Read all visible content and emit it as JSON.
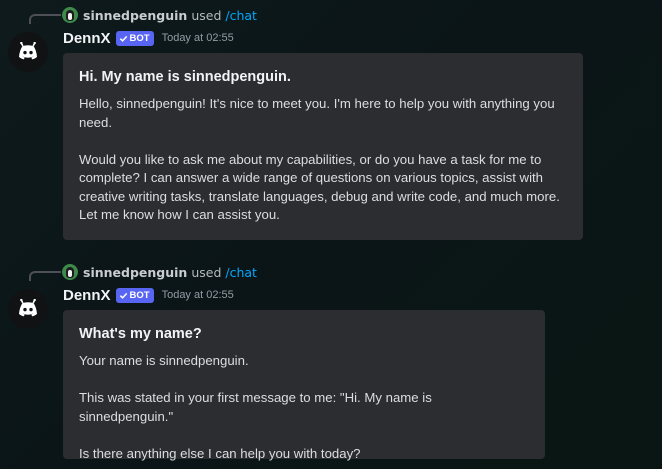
{
  "messages": [
    {
      "interaction": {
        "user": "sinnedpenguin",
        "used_text": "used",
        "command": "/chat"
      },
      "author": {
        "name": "DennX",
        "badge": "BOT"
      },
      "timestamp": "Today at 02:55",
      "embed": {
        "title": "Hi. My name is sinnedpenguin.",
        "paragraphs": [
          "Hello, sinnedpenguin! It's nice to meet you. I'm here to help you with anything you need.",
          "Would you like to ask me about my capabilities, or do you have a task for me to complete? I can answer a wide range of questions on various topics, assist with creative writing tasks, translate languages, debug and write code, and much more. Let me know how I can assist you."
        ]
      }
    },
    {
      "interaction": {
        "user": "sinnedpenguin",
        "used_text": "used",
        "command": "/chat"
      },
      "author": {
        "name": "DennX",
        "badge": "BOT"
      },
      "timestamp": "Today at 02:55",
      "embed": {
        "title": "What's my name?",
        "paragraphs": [
          "Your name is sinnedpenguin.",
          "This was stated in your first message to me: \"Hi. My name is sinnedpenguin.\"",
          "Is there anything else I can help you with today?"
        ]
      }
    }
  ],
  "colors": {
    "background": "#0d1719",
    "embed_background": "#2b2d31",
    "badge": "#5865f2",
    "command_link": "#00a8fc",
    "timestamp": "#949ba4",
    "author_name": "#f2f3f5"
  },
  "icons": {
    "bot_avatar": "discord-logo-icon",
    "user_avatar": "penguin-avatar-icon",
    "badge_check": "checkmark-icon"
  }
}
